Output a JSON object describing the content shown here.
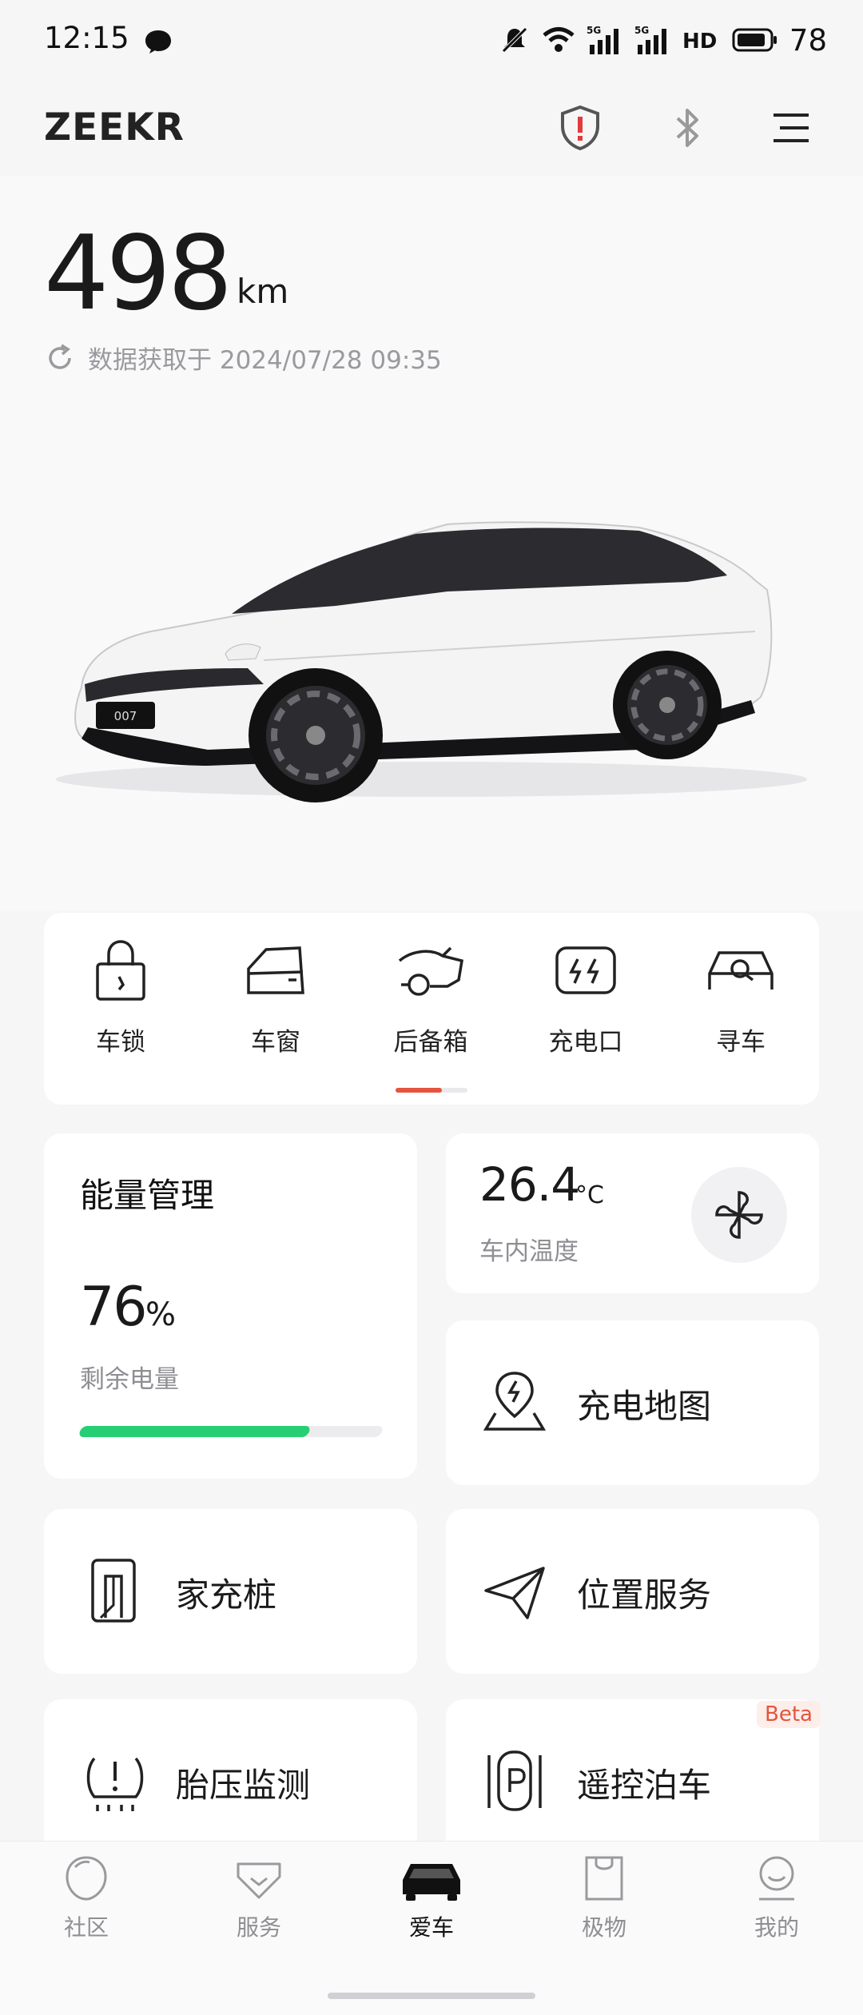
{
  "status_bar": {
    "time": "12:15",
    "network": "5G 5G HD",
    "battery": "78"
  },
  "header": {
    "brand": "ZEEKR"
  },
  "vehicle": {
    "range_value": "498",
    "range_unit": "km",
    "update_text": "数据获取于 2024/07/28 09:35",
    "plate_text": "007"
  },
  "quick_actions": [
    {
      "label": "车锁",
      "icon": "lock-icon"
    },
    {
      "label": "车窗",
      "icon": "window-icon"
    },
    {
      "label": "后备箱",
      "icon": "trunk-icon"
    },
    {
      "label": "充电口",
      "icon": "charge-port-icon"
    },
    {
      "label": "寻车",
      "icon": "find-car-icon"
    }
  ],
  "energy": {
    "title": "能量管理",
    "value": "76",
    "unit": "%",
    "label": "剩余电量",
    "level": 0.76,
    "bar_color": "#26cf73"
  },
  "climate": {
    "value": "26.4",
    "unit": "°C",
    "label": "车内温度"
  },
  "tiles": {
    "charge_map": "充电地图",
    "home_charger": "家充桩",
    "location": "位置服务",
    "tire_pressure": "胎压监测",
    "remote_parking": "遥控泊车",
    "beta_badge": "Beta"
  },
  "bottom_nav": [
    {
      "label": "社区",
      "icon": "community-icon",
      "active": false
    },
    {
      "label": "服务",
      "icon": "service-icon",
      "active": false
    },
    {
      "label": "爱车",
      "icon": "car-icon",
      "active": true
    },
    {
      "label": "极物",
      "icon": "shop-bag-icon",
      "active": false
    },
    {
      "label": "我的",
      "icon": "profile-icon",
      "active": false
    }
  ],
  "colors": {
    "accent": "#e4553d",
    "battery_green": "#26cf73",
    "background": "#f6f6f7"
  }
}
